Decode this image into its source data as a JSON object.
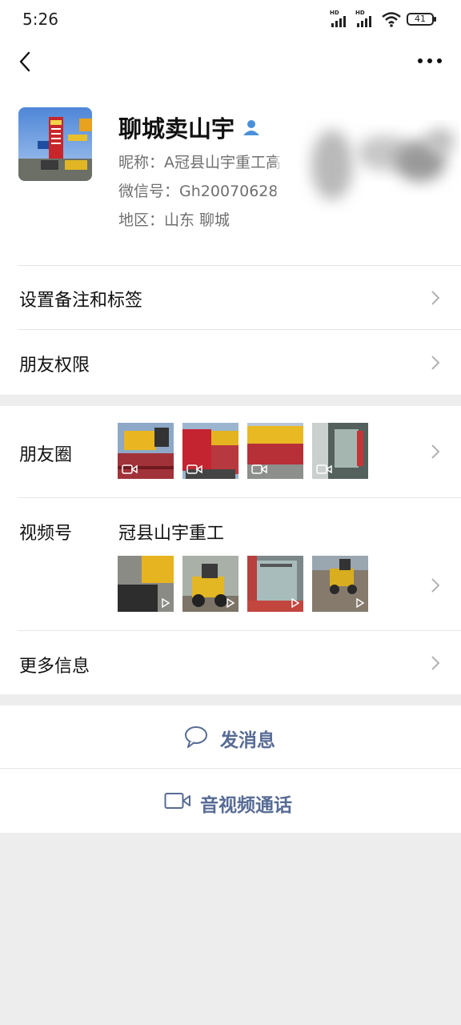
{
  "status_bar": {
    "time": "5:26",
    "battery": "41"
  },
  "profile": {
    "name": "聊城卖山宇",
    "nickname": "昵称：A冠县山宇重工高",
    "wechat_id": "微信号：Gh20070628",
    "region": "地区：山东  聊城"
  },
  "menu": {
    "remark": "设置备注和标签",
    "permissions": "朋友权限",
    "moments": "朋友圈",
    "channels": "视频号",
    "channels_name": "冠县山宇重工",
    "more_info": "更多信息"
  },
  "actions": {
    "message": "发消息",
    "call": "音视频通话"
  },
  "colors": {
    "link": "#576b95",
    "verified": "#4a90d9"
  }
}
